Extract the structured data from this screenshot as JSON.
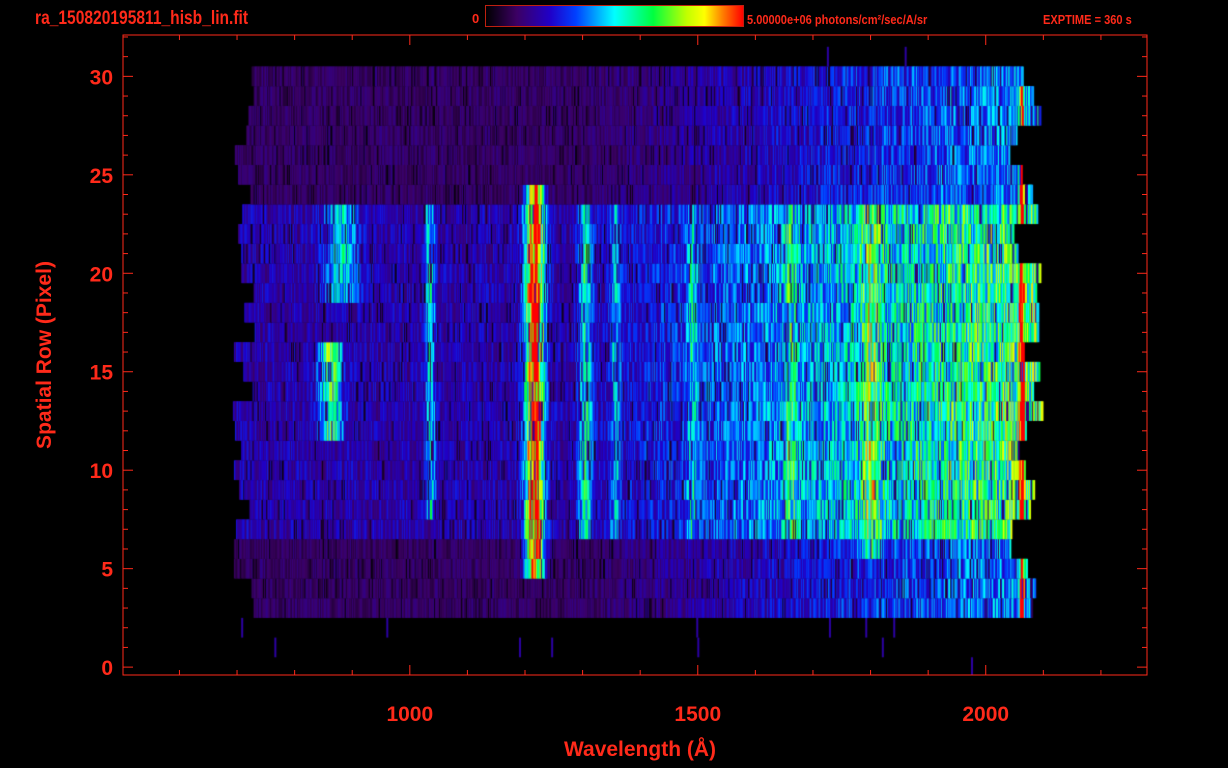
{
  "header": {
    "title": "ra_150820195811_hisb_lin.fit",
    "colorbar_min": "0",
    "colorbar_max": "5.00000e+06 photons/cm²/sec/A/sr",
    "exptime": "EXPTIME = 360 s"
  },
  "colors": {
    "axis": "#ff2a1a",
    "background": "#000000",
    "colormap": [
      "#000000",
      "#3c0064",
      "#2000c8",
      "#0040ff",
      "#00ffff",
      "#00ff40",
      "#c0ff00",
      "#ffff00",
      "#ff8000",
      "#ff0000"
    ],
    "colormap_positions": [
      0,
      0.12,
      0.25,
      0.35,
      0.5,
      0.65,
      0.78,
      0.85,
      0.92,
      1
    ]
  },
  "chart_data": {
    "type": "heatmap",
    "title": "ra_150820195811_hisb_lin.fit",
    "xlabel": "Wavelength (Å)",
    "ylabel": "Spatial Row (Pixel)",
    "xlim": [
      502,
      2280
    ],
    "ylim": [
      -0.4,
      32.1
    ],
    "x_ticks": [
      1000,
      1500,
      2000
    ],
    "x_tick_labels": [
      "1000",
      "1500",
      "2000"
    ],
    "x_minor_step": 100,
    "y_ticks": [
      0,
      5,
      10,
      15,
      20,
      25,
      30
    ],
    "y_tick_labels": [
      "0",
      "5",
      "10",
      "15",
      "20",
      "25",
      "30"
    ],
    "y_minor_step": 1,
    "value_range": [
      0,
      5000000
    ],
    "rows": 31,
    "signal_wavelength_range": [
      690,
      2100
    ],
    "detector_rows": [
      3,
      30
    ],
    "object_rows": [
      7,
      23
    ],
    "bright_continuum": {
      "rows": [
        11,
        13
      ],
      "wavelength_range": [
        1700,
        2060
      ],
      "level": 0.72
    },
    "emission_lines": [
      {
        "wavelength": 1216,
        "width": 11,
        "level": 0.92,
        "rows": [
          5,
          24
        ]
      },
      {
        "wavelength": 1035,
        "width": 6,
        "level": 0.3,
        "rows": [
          8,
          23
        ]
      },
      {
        "wavelength": 1304,
        "width": 8,
        "level": 0.35,
        "rows": [
          7,
          23
        ]
      },
      {
        "wavelength": 1356,
        "width": 6,
        "level": 0.22,
        "rows": [
          7,
          23
        ]
      },
      {
        "wavelength": 1490,
        "width": 6,
        "level": 0.2,
        "rows": [
          7,
          23
        ]
      },
      {
        "wavelength": 1660,
        "width": 8,
        "level": 0.2,
        "rows": [
          7,
          23
        ]
      },
      {
        "wavelength": 1800,
        "width": 12,
        "level": 0.25,
        "rows": [
          6,
          23
        ]
      },
      {
        "wavelength": 862,
        "width": 14,
        "level": 0.45,
        "rows": [
          12,
          16
        ]
      },
      {
        "wavelength": 880,
        "width": 20,
        "level": 0.3,
        "rows": [
          19,
          23
        ]
      },
      {
        "wavelength": 2062,
        "width": 3,
        "level": 0.9,
        "rows": [
          3,
          29
        ]
      }
    ]
  },
  "labels": {
    "xlabel": "Wavelength (Å)",
    "ylabel": "Spatial Row (Pixel)"
  }
}
